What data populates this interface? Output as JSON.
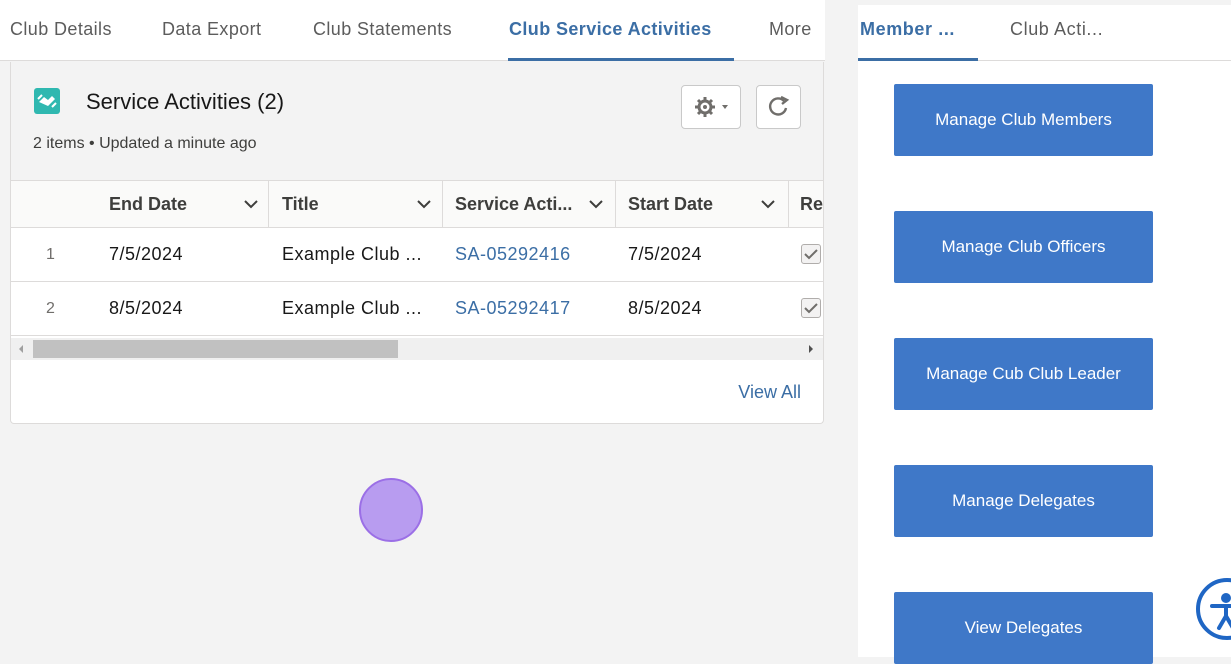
{
  "left_tabs": [
    {
      "label": "Club Details"
    },
    {
      "label": "Data Export"
    },
    {
      "label": "Club Statements"
    },
    {
      "label": "Club Service Activities",
      "active": true
    },
    {
      "label": "More"
    }
  ],
  "card": {
    "icon": "handshake-icon",
    "icon_color": "#2fb8b0",
    "title": "Service Activities (2)",
    "subtitle": "2 items • Updated a minute ago",
    "gear_icon": "gear-icon",
    "refresh_icon": "refresh-icon"
  },
  "table": {
    "columns": [
      "End Date",
      "Title",
      "Service Acti...",
      "Start Date",
      "Re"
    ],
    "rows": [
      {
        "num": "1",
        "end_date": "7/5/2024",
        "title": "Example Club ...",
        "service_activity": "SA-05292416",
        "start_date": "7/5/2024",
        "checked": true
      },
      {
        "num": "2",
        "end_date": "8/5/2024",
        "title": "Example Club ...",
        "service_activity": "SA-05292417",
        "start_date": "8/5/2024",
        "checked": true
      }
    ],
    "view_all": "View All"
  },
  "right_tabs": [
    {
      "label": "Member ...",
      "active": true
    },
    {
      "label": "Club Acti..."
    }
  ],
  "actions": [
    {
      "label": "Manage Club Members"
    },
    {
      "label": "Manage Club Officers"
    },
    {
      "label": "Manage Cub Club Leader"
    },
    {
      "label": "Manage Delegates"
    },
    {
      "label": "View Delegates"
    }
  ],
  "colors": {
    "accent": "#3b6ea5",
    "button": "#3f78c8",
    "cursor": "#b89cf0"
  },
  "accessibility_icon": "accessibility-icon"
}
